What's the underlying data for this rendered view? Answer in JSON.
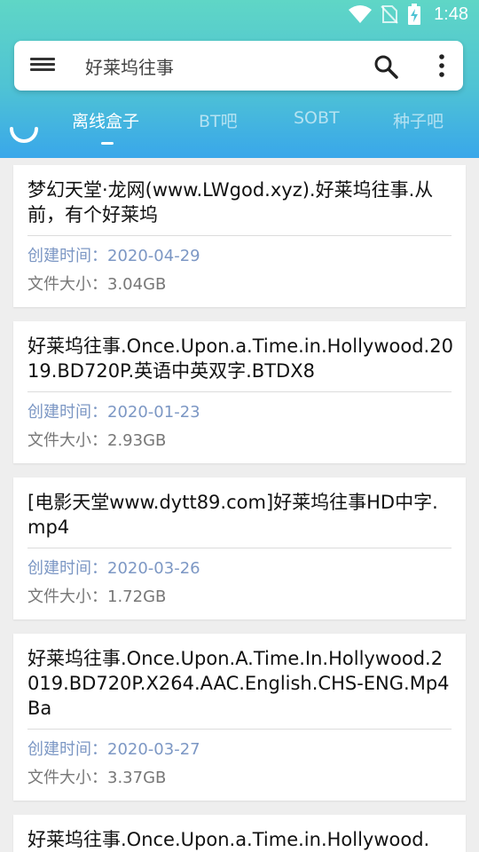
{
  "status_bar": {
    "time": "1:48",
    "icons": [
      "wifi-icon",
      "sim-off-icon",
      "battery-charging-icon"
    ]
  },
  "search": {
    "query": "好莱坞往事"
  },
  "tabs": [
    {
      "label": "离线盒子",
      "active": true
    },
    {
      "label": "BT吧",
      "active": false
    },
    {
      "label": "SOBT",
      "active": false
    },
    {
      "label": "种子吧",
      "active": false
    }
  ],
  "results": [
    {
      "title": "梦幻天堂·龙网(www.LWgod.xyz).好莱坞往事.从前，有个好莱坞",
      "date": "创建时间：2020-04-29",
      "size": "文件大小：3.04GB"
    },
    {
      "title": "好莱坞往事.Once.Upon.a.Time.in.Hollywood.2019.BD720P.英语中英双字.BTDX8",
      "date": "创建时间：2020-01-23",
      "size": "文件大小：2.93GB"
    },
    {
      "title": "[电影天堂www.dytt89.com]好莱坞往事HD中字.mp4",
      "date": "创建时间：2020-03-26",
      "size": "文件大小：1.72GB"
    },
    {
      "title": "好莱坞往事.Once.Upon.A.Time.In.Hollywood.2019.BD720P.X264.AAC.English.CHS-ENG.Mp4Ba",
      "date": "创建时间：2020-03-27",
      "size": "文件大小：3.37GB"
    },
    {
      "title": "好莱坞往事.Once.Upon.a.Time.in.Hollywood.",
      "date": "",
      "size": ""
    }
  ],
  "colors": {
    "accent_top": "#5fd6c6",
    "accent_bottom": "#39a7ea",
    "date_color": "#7c97c4"
  }
}
